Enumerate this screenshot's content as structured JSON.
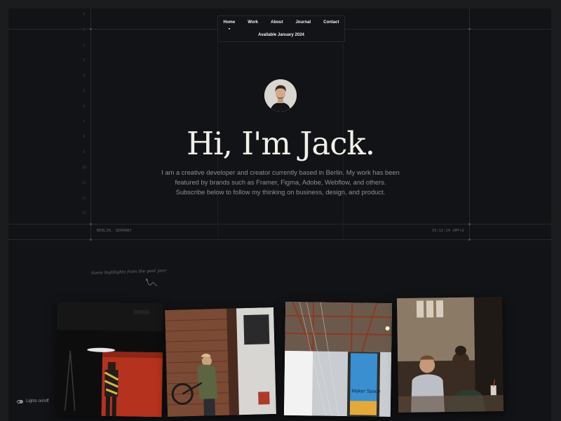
{
  "nav": {
    "links": [
      "Home",
      "Work",
      "About",
      "Journal",
      "Contact"
    ],
    "availability": "Available January 2024"
  },
  "hero": {
    "headline": "Hi, I'm Jack.",
    "bio": "I am a creative developer and creator currently based in Berlin. My work has been featured by brands such as Framer, Figma, Adobe, Webflow, and others. Subscribe below to follow my thinking on business, design, and product."
  },
  "meta": {
    "location": "BERLIN, GERMANY",
    "time": "19:12:29 GMT+2"
  },
  "ruler_marks": [
    "0",
    "1",
    "2",
    "3",
    "4",
    "5",
    "6",
    "7",
    "8",
    "9",
    "10",
    "11",
    "12",
    "13"
  ],
  "highlights": {
    "caption": "Some highlights from the past year",
    "photos": [
      {
        "name": "photo-studio-shoot",
        "sign_text": ""
      },
      {
        "name": "photo-cyclist-brick-wall",
        "sign_text": ""
      },
      {
        "name": "photo-maker-space",
        "sign_text": "Maker Space"
      },
      {
        "name": "photo-cafe-meeting",
        "sign_text": ""
      }
    ]
  },
  "footer": {
    "lights_toggle": "Lights on/off"
  },
  "colors": {
    "background": "#121316",
    "text": "#f1efe9",
    "muted": "#8d8f93"
  }
}
